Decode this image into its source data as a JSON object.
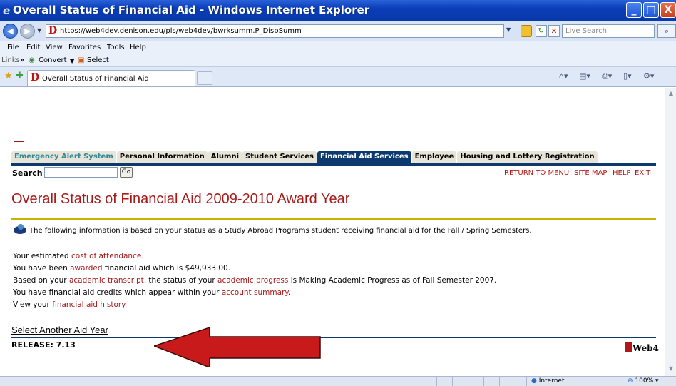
{
  "window": {
    "title": "Overall Status of Financial Aid - Windows Internet Explorer",
    "min_glyph": "_",
    "max_glyph": "□",
    "close_glyph": "X"
  },
  "address": {
    "url": "https://web4dev.denison.edu/pls/web4dev/bwrksumm.P_DispSumm",
    "live_search_placeholder": "Live Search"
  },
  "menu": {
    "items": [
      "File",
      "Edit",
      "View",
      "Favorites",
      "Tools",
      "Help"
    ]
  },
  "links_bar": {
    "label": "Links",
    "chevron": "»",
    "convert": "Convert",
    "select": "Select"
  },
  "browser_tab": {
    "label": "Overall Status of Financial Aid"
  },
  "site_nav": {
    "tabs": [
      {
        "label": "Emergency Alert System"
      },
      {
        "label": "Personal Information"
      },
      {
        "label": "Alumni"
      },
      {
        "label": "Student Services"
      },
      {
        "label": "Financial Aid Services"
      },
      {
        "label": "Employee"
      },
      {
        "label": "Housing and Lottery Registration"
      }
    ],
    "search_label": "Search",
    "go_label": "Go",
    "top_links": {
      "return": "RETURN TO MENU",
      "sitemap": "SITE MAP",
      "help": "HELP",
      "exit": "EXIT"
    }
  },
  "page": {
    "title": "Overall Status of Financial Aid 2009-2010 Award Year",
    "info_text": "The following information is based on your status as a Study Abroad Programs student receiving financial aid for the Fall / Spring Semesters.",
    "line1": {
      "pre": "Your estimated ",
      "link": "cost of attendance",
      "post": "."
    },
    "line2": {
      "pre": "You have been ",
      "link": "awarded",
      "post": " financial aid which is $49,933.00."
    },
    "line3": {
      "pre": "Based on your ",
      "link1": "academic transcript",
      "mid": ", the status of your ",
      "link2": "academic progress",
      "post": " is Making Academic Progress as of Fall Semester 2007."
    },
    "line4": {
      "pre": "You have financial aid credits which appear within your ",
      "link": "account summary",
      "post": "."
    },
    "line5": {
      "pre": "View your ",
      "link": "financial aid history",
      "post": "."
    },
    "select_another": "Select Another Aid Year",
    "release": "RELEASE: 7.13",
    "web4_logo": "Web4"
  },
  "status": {
    "zone": "Internet",
    "zoom": "100%"
  },
  "colors": {
    "link": "#a81a1a",
    "nav_active": "#0d3a6e",
    "gold_rule": "#c8b400",
    "arrow": "#c81a1a"
  }
}
